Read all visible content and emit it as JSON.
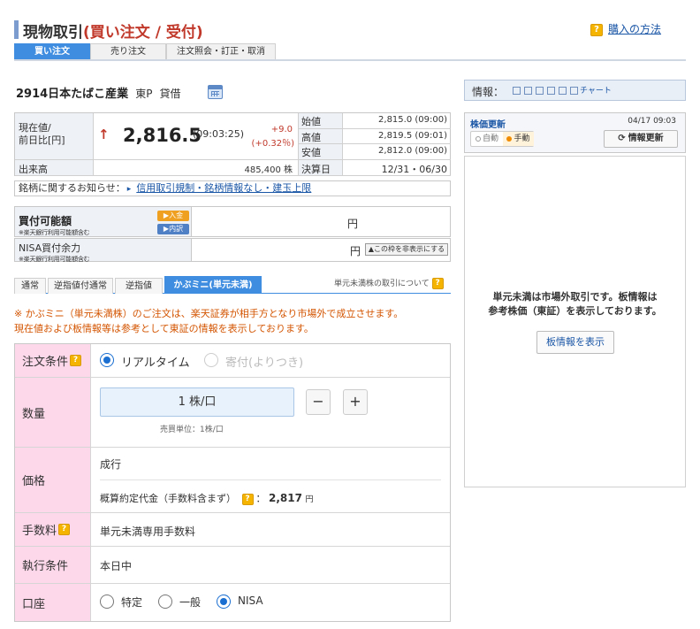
{
  "header": {
    "title_prefix": "現物取引",
    "title_emph": "(買い注文 / 受付)",
    "help_link": "購入の方法",
    "tabs": [
      "買い注文",
      "売り注文",
      "注文照会・訂正・取消"
    ],
    "active_tab": 0
  },
  "stock": {
    "code_name": "2914日本たばこ産業",
    "market": "東P",
    "margin_type": "貸借"
  },
  "price": {
    "current_label_1": "現在値/",
    "current_label_2": "前日比[円]",
    "arrow": "↑",
    "current": "2,816.5",
    "time": "(09:03:25)",
    "change": "+9.0",
    "change_pct": "(+0.32％)",
    "volume_label": "出来高",
    "volume": "485,400 株",
    "open_label": "始値",
    "open": "2,815.0 (09:00)",
    "high_label": "高値",
    "high": "2,819.5 (09:01)",
    "low_label": "安値",
    "low": "2,812.0 (09:00)",
    "settle_label": "決算日",
    "settle": "12/31・06/30"
  },
  "notice": {
    "label": "銘柄に関するお知らせ：",
    "link": "信用取引規制・銘柄情報なし・建玉上限"
  },
  "buying_power": {
    "label": "買付可能額",
    "sub": "※楽天銀行利用可能額含む",
    "btn_deposit": "▶入金",
    "btn_detail": "▶内訳",
    "unit": "円",
    "nisa_label": "NISA買付余力",
    "nisa_sub": "※楽天銀行利用可能額含む",
    "nisa_unit": "円",
    "hide_btn": "▲この枠を非表示にする"
  },
  "order_tabs": {
    "items": [
      "通常",
      "逆指値付通常",
      "逆指値",
      "かぶミニ(単元未満)"
    ],
    "active": 3,
    "note": "単元未満株の取引について"
  },
  "warning": {
    "line1": "※ かぶミニ（単元未満株）のご注文は、楽天証券が相手方となり市場外で成立させます。",
    "line2": "現在値および板情報等は参考として東証の情報を表示しております。"
  },
  "form": {
    "cond_label": "注文条件",
    "cond_opt1": "リアルタイム",
    "cond_opt2": "寄付(よりつき)",
    "qty_label": "数量",
    "qty_value": "1 株/口",
    "qty_minus": "−",
    "qty_plus": "+",
    "qty_unit_note": "売買単位：1株/口",
    "price_label": "価格",
    "price_type": "成行",
    "est_label": "概算約定代金（手数料含まず）",
    "est_value": "2,817",
    "est_unit": "円",
    "fee_label": "手数料",
    "fee_value": "単元未満専用手数料",
    "exec_label": "執行条件",
    "exec_value": "本日中",
    "account_label": "口座",
    "account_opts": [
      "特定",
      "一般",
      "NISA"
    ],
    "account_selected": 2
  },
  "right": {
    "info_label": "情報：",
    "chart_label": "チャート",
    "update_title": "株価更新",
    "update_time": "04/17 09:03",
    "auto_label": "自動",
    "manual_label": "手動",
    "refresh_btn": "情報更新",
    "board_msg1": "単元未満は市場外取引です。板情報は",
    "board_msg2": "参考株価（東証）を表示しております。",
    "board_btn": "板情報を表示"
  },
  "colors": {
    "accent_blue": "#3e8de0",
    "price_up_red": "#c0392b",
    "label_pink": "#fdd8ea",
    "warning_orange": "#d35400"
  }
}
